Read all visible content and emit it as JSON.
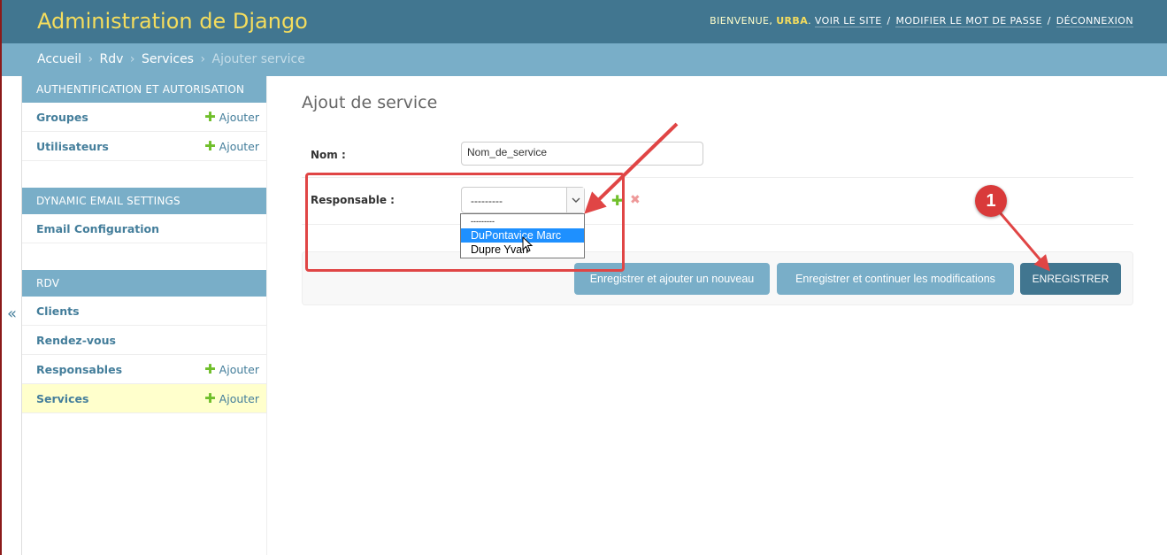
{
  "header": {
    "title": "Administration de Django",
    "welcome": "Bienvenue,",
    "username": "urba",
    "view_site": "Voir le site",
    "change_password": "Modifier le mot de passe",
    "logout": "Déconnexion",
    "separator": "/"
  },
  "breadcrumbs": {
    "home": "Accueil",
    "app": "Rdv",
    "model": "Services",
    "current": "Ajouter service",
    "separator": "›"
  },
  "nav_toggle": "«",
  "sidebar": {
    "modules": [
      {
        "caption": "Authentification et autorisation",
        "rows": [
          {
            "name": "Groupes",
            "add": "Ajouter"
          },
          {
            "name": "Utilisateurs",
            "add": "Ajouter"
          }
        ]
      },
      {
        "caption": "Dynamic Email Settings",
        "rows": [
          {
            "name": "Email Configuration"
          }
        ]
      },
      {
        "caption": "Rdv",
        "rows": [
          {
            "name": "Clients"
          },
          {
            "name": "Rendez-vous"
          },
          {
            "name": "Responsables",
            "add": "Ajouter"
          },
          {
            "name": "Services",
            "add": "Ajouter",
            "current": true
          }
        ]
      }
    ],
    "add_icon": "plus-icon"
  },
  "form": {
    "title": "Ajout de service",
    "nom_label": "Nom :",
    "nom_value": "Nom_de_service",
    "responsable_label": "Responsable :",
    "responsable_value": "---------",
    "responsable_options": [
      "---------",
      "DuPontavice Marc",
      "Dupre Yvan"
    ],
    "highlighted_option": "DuPontavice Marc"
  },
  "buttons": {
    "save_add_another": "Enregistrer et ajouter un nouveau",
    "save_continue": "Enregistrer et continuer les modifications",
    "save": "Enregistrer"
  },
  "annotation": {
    "badge": "1",
    "color": "#e04545"
  },
  "colors": {
    "header_bg": "#417690",
    "brand": "#f5dd5d",
    "breadcrumbs_bg": "#79aec8",
    "add_green": "#70bf2b",
    "link": "#447e9b"
  }
}
